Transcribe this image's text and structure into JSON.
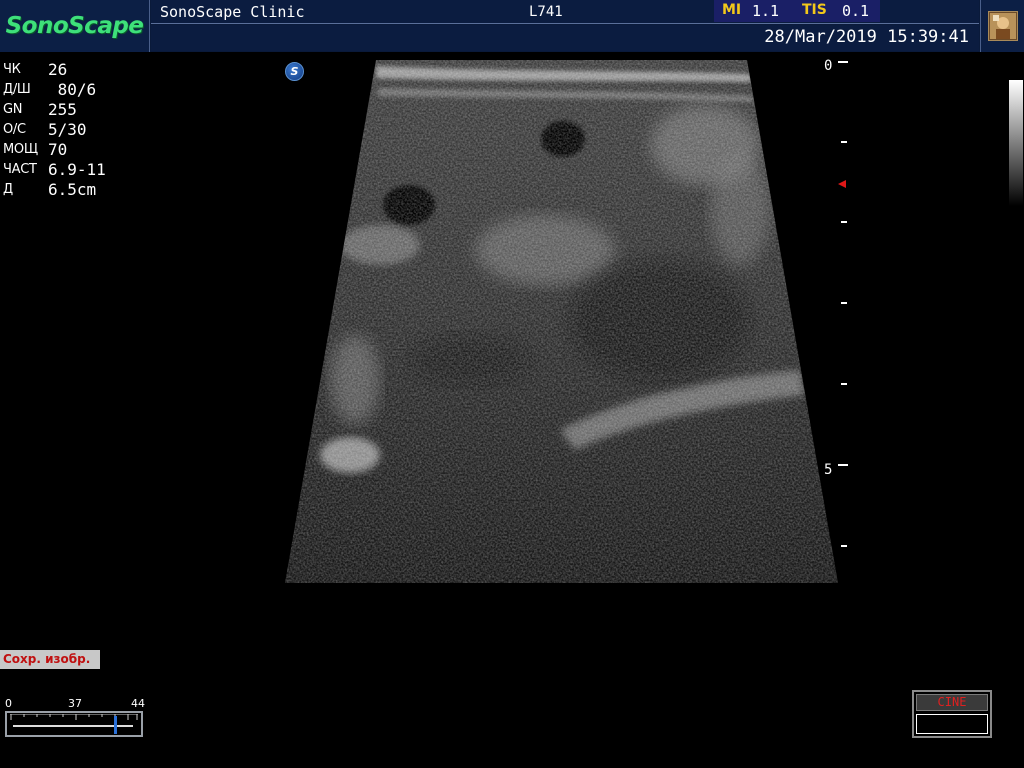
{
  "header": {
    "logo": "SonoScape",
    "clinic": "SonoScape Clinic",
    "probe": "L741",
    "mi_label": "MI",
    "mi_value": "1.1",
    "tis_label": "TIS",
    "tis_value": "0.1",
    "datetime": "28/Mar/2019 15:39:41",
    "avatar_icon": "user-photo-icon"
  },
  "params": [
    {
      "key": "ЧК",
      "value": "26"
    },
    {
      "key": "Д/Ш",
      "value": " 80/6"
    },
    {
      "key": "GN",
      "value": "255"
    },
    {
      "key": "О/С",
      "value": "5/30"
    },
    {
      "key": "МОЩ",
      "value": "70"
    },
    {
      "key": "ЧАСТ",
      "value": "6.9-11"
    },
    {
      "key": "Д",
      "value": "6.5cm"
    }
  ],
  "badge": "S",
  "depth_scale": {
    "labels": [
      "0",
      "5"
    ],
    "focus_marker_color": "#e01818"
  },
  "save_button": "Сохр. изобр.",
  "cine_slider": {
    "min": "0",
    "mid": "37",
    "max": "44",
    "position_fraction": 0.84
  },
  "cine": {
    "label": "CINE",
    "value": ""
  },
  "colors": {
    "logo": "#3ee07a",
    "header_bg": "#0b1c40",
    "mi_tis": "#f2c81a",
    "cine_text": "#e02020",
    "save_text": "#c01010"
  }
}
